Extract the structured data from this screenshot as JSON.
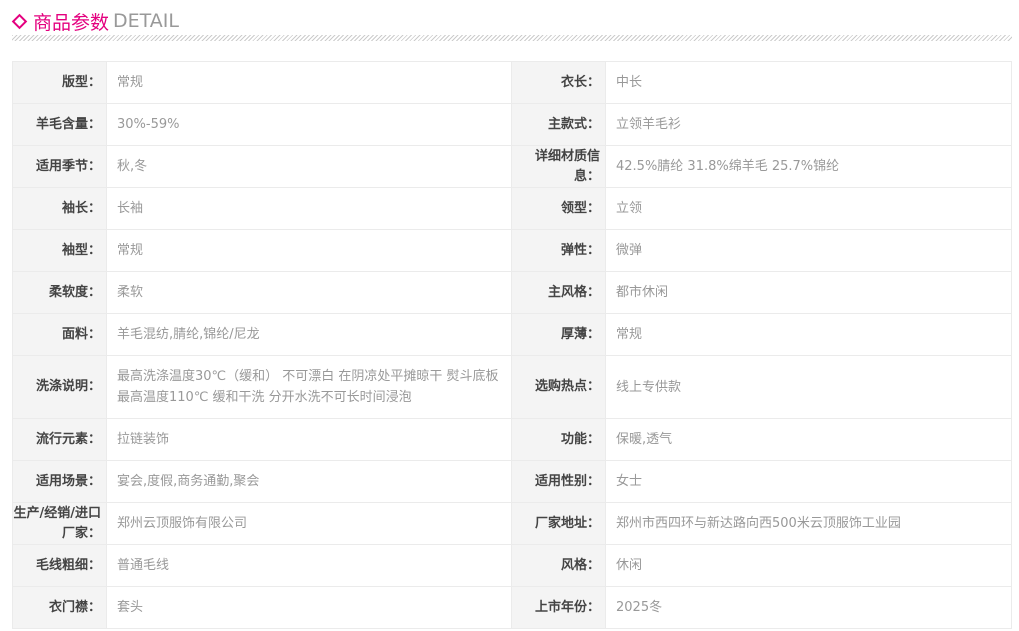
{
  "header": {
    "title": "商品参数",
    "subtitle": "DETAIL"
  },
  "rows": [
    {
      "left": {
        "label": "版型：",
        "value": "常规"
      },
      "right": {
        "label": "衣长：",
        "value": "中长"
      }
    },
    {
      "left": {
        "label": "羊毛含量：",
        "value": "30%-59%"
      },
      "right": {
        "label": "主款式：",
        "value": "立领羊毛衫"
      }
    },
    {
      "left": {
        "label": "适用季节：",
        "value": "秋,冬"
      },
      "right": {
        "label": "详细材质信息：",
        "value": "42.5%腈纶 31.8%绵羊毛 25.7%锦纶"
      }
    },
    {
      "left": {
        "label": "袖长：",
        "value": "长袖"
      },
      "right": {
        "label": "领型：",
        "value": "立领"
      }
    },
    {
      "left": {
        "label": "袖型：",
        "value": "常规"
      },
      "right": {
        "label": "弹性：",
        "value": "微弹"
      }
    },
    {
      "left": {
        "label": "柔软度：",
        "value": "柔软"
      },
      "right": {
        "label": "主风格：",
        "value": "都市休闲"
      }
    },
    {
      "left": {
        "label": "面料：",
        "value": "羊毛混纺,腈纶,锦纶/尼龙"
      },
      "right": {
        "label": "厚薄：",
        "value": "常规"
      }
    },
    {
      "left": {
        "label": "洗涤说明：",
        "value": "最高洗涤温度30℃（缓和） 不可漂白 在阴凉处平摊晾干 熨斗底板最高温度110℃ 缓和干洗 分开水洗不可长时间浸泡"
      },
      "right": {
        "label": "选购热点：",
        "value": "线上专供款"
      }
    },
    {
      "left": {
        "label": "流行元素：",
        "value": "拉链装饰"
      },
      "right": {
        "label": "功能：",
        "value": "保暖,透气"
      }
    },
    {
      "left": {
        "label": "适用场景：",
        "value": "宴会,度假,商务通勤,聚会"
      },
      "right": {
        "label": "适用性别：",
        "value": "女士"
      }
    },
    {
      "left": {
        "label": "生产/经销/进口厂家：",
        "value": "郑州云顶服饰有限公司"
      },
      "right": {
        "label": "厂家地址：",
        "value": "郑州市西四环与新达路向西500米云顶服饰工业园"
      }
    },
    {
      "left": {
        "label": "毛线粗细：",
        "value": "普通毛线"
      },
      "right": {
        "label": "风格：",
        "value": "休闲"
      }
    },
    {
      "left": {
        "label": "衣门襟：",
        "value": "套头"
      },
      "right": {
        "label": "上市年份：",
        "value": "2025冬"
      }
    }
  ]
}
